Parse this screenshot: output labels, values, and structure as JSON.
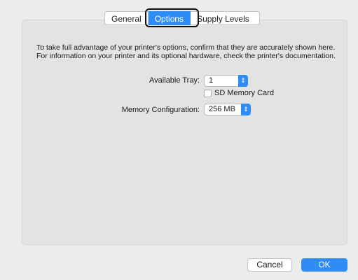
{
  "tabs": [
    {
      "label": "General"
    },
    {
      "label": "Options",
      "selected": true
    },
    {
      "label": "Supply Levels"
    }
  ],
  "intro_text": "To take full advantage of your printer's options, confirm that they are accurately shown here. For information on your printer and its optional hardware, check the printer's documentation.",
  "available_tray": {
    "label": "Available Tray:",
    "value": "1"
  },
  "sd_card": {
    "label": "SD Memory Card",
    "checked": false
  },
  "memory": {
    "label": "Memory Configuration:",
    "value": "256 MB"
  },
  "buttons": {
    "cancel": "Cancel",
    "ok": "OK"
  },
  "colors": {
    "accent": "#2f8cf5",
    "panel": "#e3e3e3",
    "window": "#ececec"
  },
  "icons": {
    "popup_arrow": "up-down-chevron-icon"
  }
}
